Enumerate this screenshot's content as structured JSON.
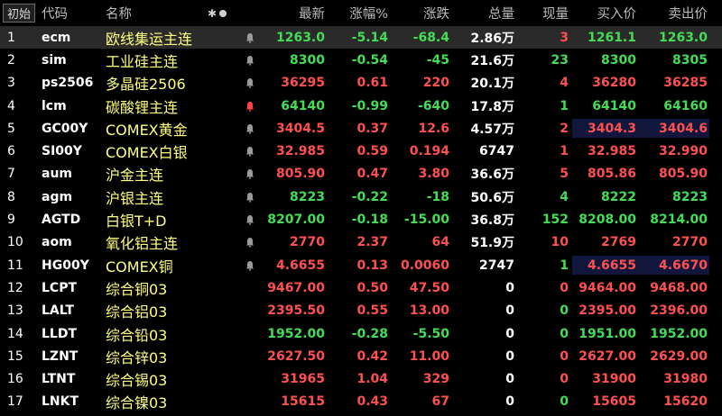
{
  "header": {
    "tab": "初始",
    "columns": [
      "代码",
      "名称",
      "最新",
      "涨幅%",
      "涨跌",
      "总量",
      "现量",
      "买入价",
      "卖出价"
    ],
    "sort_glyph": "✱"
  },
  "colors": {
    "up": "#ff5050",
    "down": "#44dd55",
    "bell_active": "#ff4444",
    "bell_idle": "#9a9a9a"
  },
  "rows": [
    {
      "idx": "1",
      "code": "ecm",
      "name": "欧线集运主连",
      "bell": "bell-icon",
      "last": "1263.0",
      "pct": "-5.14",
      "chg": "-68.4",
      "vol": "2.86万",
      "cur": "3",
      "bid": "1261.1",
      "ask": "1263.0",
      "dir": "down",
      "cur_dir": "up",
      "bid_dir": "down",
      "ask_dir": "down",
      "selected": true
    },
    {
      "idx": "2",
      "code": "sim",
      "name": "工业硅主连",
      "bell": "bell-icon",
      "last": "8300",
      "pct": "-0.54",
      "chg": "-45",
      "vol": "21.6万",
      "cur": "23",
      "bid": "8300",
      "ask": "8305",
      "dir": "down",
      "cur_dir": "down",
      "bid_dir": "down",
      "ask_dir": "down"
    },
    {
      "idx": "3",
      "code": "ps2506",
      "name": "多晶硅2506",
      "bell": "bell-icon",
      "last": "36295",
      "pct": "0.61",
      "chg": "220",
      "vol": "20.1万",
      "cur": "4",
      "bid": "36280",
      "ask": "36285",
      "dir": "up",
      "cur_dir": "up",
      "bid_dir": "up",
      "ask_dir": "up"
    },
    {
      "idx": "4",
      "code": "lcm",
      "name": "碳酸锂主连",
      "bell": "bell-icon-active",
      "last": "64140",
      "pct": "-0.99",
      "chg": "-640",
      "vol": "17.8万",
      "cur": "1",
      "bid": "64140",
      "ask": "64160",
      "dir": "down",
      "cur_dir": "down",
      "bid_dir": "down",
      "ask_dir": "down"
    },
    {
      "idx": "5",
      "code": "GC00Y",
      "name": "COMEX黄金",
      "bell": "bell-icon",
      "last": "3404.5",
      "pct": "0.37",
      "chg": "12.6",
      "vol": "4.57万",
      "cur": "2",
      "bid": "3404.3",
      "ask": "3404.6",
      "dir": "up",
      "cur_dir": "up",
      "bid_dir": "up",
      "ask_dir": "up",
      "bidbox": true
    },
    {
      "idx": "6",
      "code": "SI00Y",
      "name": "COMEX白银",
      "bell": "bell-icon",
      "last": "32.985",
      "pct": "0.59",
      "chg": "0.194",
      "vol": "6747",
      "cur": "1",
      "bid": "32.985",
      "ask": "32.990",
      "dir": "up",
      "cur_dir": "up",
      "bid_dir": "up",
      "ask_dir": "up"
    },
    {
      "idx": "7",
      "code": "aum",
      "name": "沪金主连",
      "bell": "bell-icon",
      "last": "805.90",
      "pct": "0.47",
      "chg": "3.80",
      "vol": "36.6万",
      "cur": "5",
      "bid": "805.86",
      "ask": "805.90",
      "dir": "up",
      "cur_dir": "up",
      "bid_dir": "up",
      "ask_dir": "up"
    },
    {
      "idx": "8",
      "code": "agm",
      "name": "沪银主连",
      "bell": "bell-icon",
      "last": "8223",
      "pct": "-0.22",
      "chg": "-18",
      "vol": "50.6万",
      "cur": "4",
      "bid": "8222",
      "ask": "8223",
      "dir": "down",
      "cur_dir": "down",
      "bid_dir": "down",
      "ask_dir": "down"
    },
    {
      "idx": "9",
      "code": "AGTD",
      "name": "白银T+D",
      "bell": "bell-icon",
      "last": "8207.00",
      "pct": "-0.18",
      "chg": "-15.00",
      "vol": "36.8万",
      "cur": "152",
      "bid": "8208.00",
      "ask": "8214.00",
      "dir": "down",
      "cur_dir": "down",
      "bid_dir": "down",
      "ask_dir": "down"
    },
    {
      "idx": "10",
      "code": "aom",
      "name": "氧化铝主连",
      "bell": "bell-icon",
      "last": "2770",
      "pct": "2.37",
      "chg": "64",
      "vol": "51.9万",
      "cur": "10",
      "bid": "2769",
      "ask": "2770",
      "dir": "up",
      "cur_dir": "up",
      "bid_dir": "up",
      "ask_dir": "up"
    },
    {
      "idx": "11",
      "code": "HG00Y",
      "name": "COMEX铜",
      "bell": "bell-icon",
      "last": "4.6655",
      "pct": "0.13",
      "chg": "0.0060",
      "vol": "2747",
      "cur": "1",
      "bid": "4.6655",
      "ask": "4.6670",
      "dir": "up",
      "cur_dir": "down",
      "bid_dir": "up",
      "ask_dir": "up",
      "bidbox": true
    },
    {
      "idx": "12",
      "code": "LCPT",
      "name": "综合铜03",
      "bell": "",
      "last": "9467.00",
      "pct": "0.50",
      "chg": "47.50",
      "vol": "0",
      "cur": "0",
      "bid": "9464.00",
      "ask": "9468.00",
      "dir": "up",
      "cur_dir": "up",
      "bid_dir": "up",
      "ask_dir": "up"
    },
    {
      "idx": "13",
      "code": "LALT",
      "name": "综合铝03",
      "bell": "",
      "last": "2395.50",
      "pct": "0.55",
      "chg": "13.00",
      "vol": "0",
      "cur": "0",
      "bid": "2395.00",
      "ask": "2396.00",
      "dir": "up",
      "cur_dir": "down",
      "bid_dir": "up",
      "ask_dir": "up"
    },
    {
      "idx": "14",
      "code": "LLDT",
      "name": "综合铅03",
      "bell": "",
      "last": "1952.00",
      "pct": "-0.28",
      "chg": "-5.50",
      "vol": "0",
      "cur": "0",
      "bid": "1951.00",
      "ask": "1952.00",
      "dir": "down",
      "cur_dir": "down",
      "bid_dir": "down",
      "ask_dir": "down"
    },
    {
      "idx": "15",
      "code": "LZNT",
      "name": "综合锌03",
      "bell": "",
      "last": "2627.50",
      "pct": "0.42",
      "chg": "11.00",
      "vol": "0",
      "cur": "0",
      "bid": "2627.00",
      "ask": "2629.00",
      "dir": "up",
      "cur_dir": "up",
      "bid_dir": "up",
      "ask_dir": "up"
    },
    {
      "idx": "16",
      "code": "LTNT",
      "name": "综合锡03",
      "bell": "",
      "last": "31965",
      "pct": "1.04",
      "chg": "329",
      "vol": "0",
      "cur": "0",
      "bid": "31900",
      "ask": "31980",
      "dir": "up",
      "cur_dir": "up",
      "bid_dir": "up",
      "ask_dir": "up"
    },
    {
      "idx": "17",
      "code": "LNKT",
      "name": "综合镍03",
      "bell": "",
      "last": "15615",
      "pct": "0.43",
      "chg": "67",
      "vol": "0",
      "cur": "0",
      "bid": "15605",
      "ask": "15620",
      "dir": "up",
      "cur_dir": "down",
      "bid_dir": "up",
      "ask_dir": "up"
    }
  ]
}
